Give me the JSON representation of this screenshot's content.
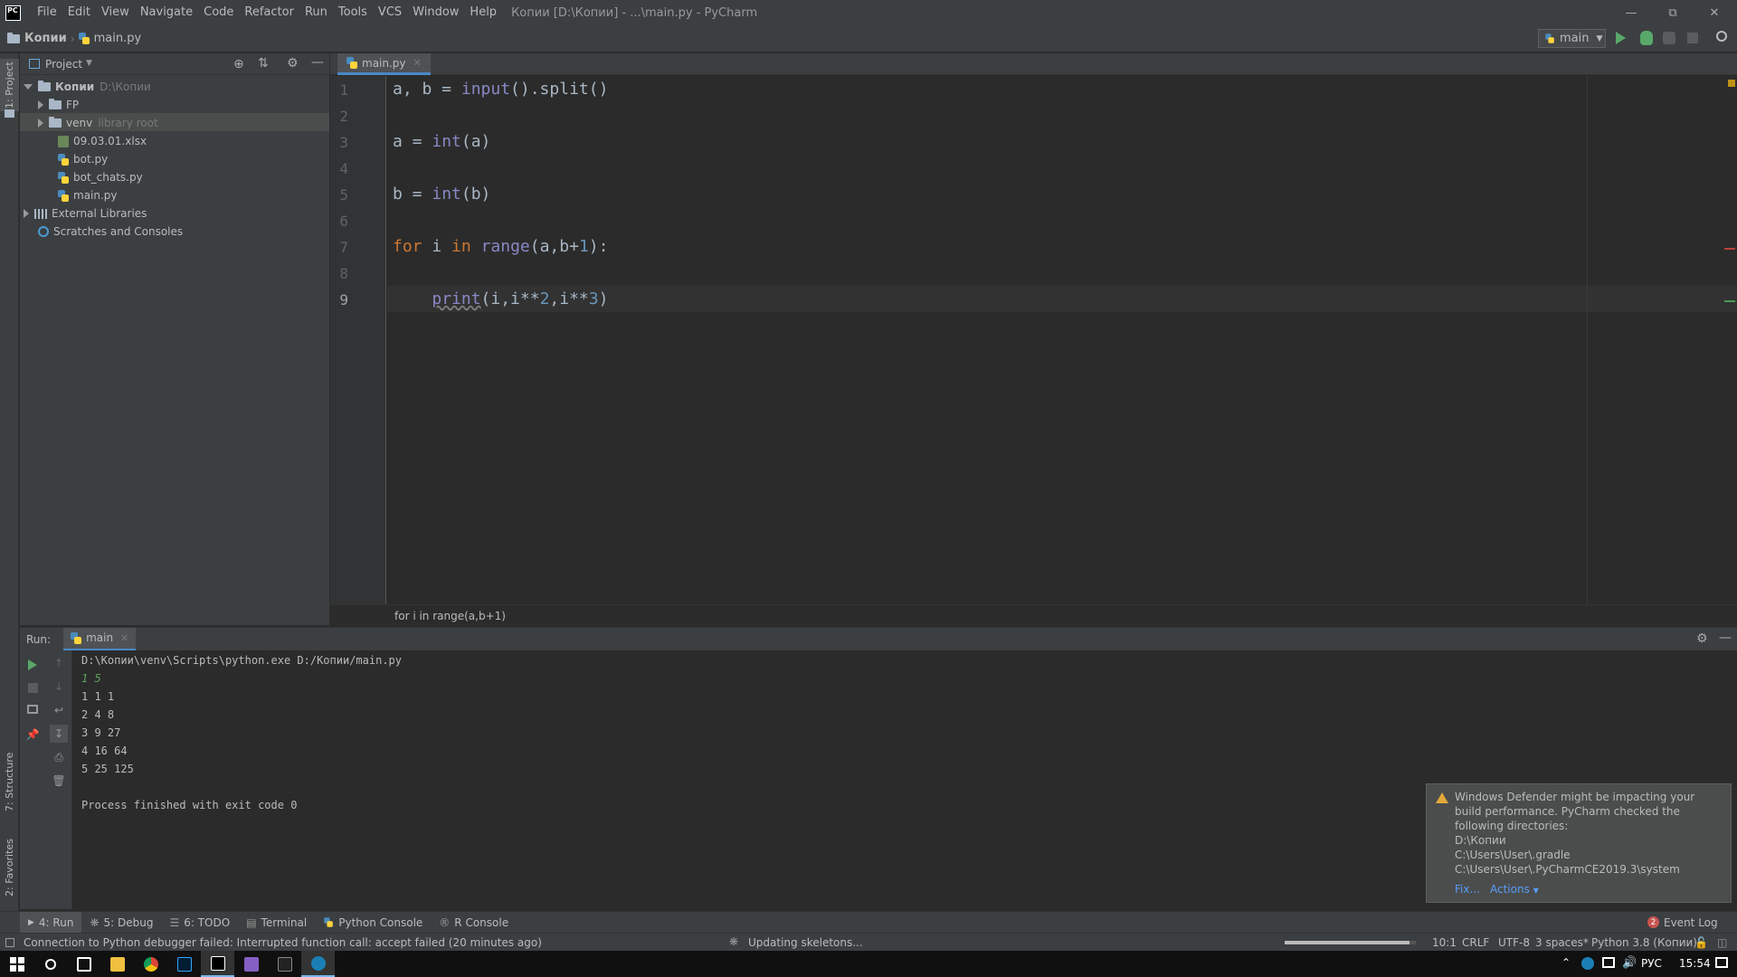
{
  "titlebar": {
    "logo": "PC",
    "menu": [
      "File",
      "Edit",
      "View",
      "Navigate",
      "Code",
      "Refactor",
      "Run",
      "Tools",
      "VCS",
      "Window",
      "Help"
    ],
    "window_title": "Копии [D:\\Копии] - ...\\main.py - PyCharm"
  },
  "navbar": {
    "crumb_project": "Копии",
    "crumb_file": "main.py",
    "run_config": "main"
  },
  "left_strip": {
    "project_tab": "1: Project",
    "structure_tab": "7: Structure",
    "favorites_tab": "2: Favorites"
  },
  "project": {
    "title": "Project",
    "root_name": "Копии",
    "root_path": "D:\\Копии",
    "items": [
      {
        "label": "FP",
        "hint": ""
      },
      {
        "label": "venv",
        "hint": "library root"
      },
      {
        "label": "09.03.01.xlsx",
        "hint": ""
      },
      {
        "label": "bot.py",
        "hint": ""
      },
      {
        "label": "bot_chats.py",
        "hint": ""
      },
      {
        "label": "main.py",
        "hint": ""
      }
    ],
    "external_libraries": "External Libraries",
    "scratches": "Scratches and Consoles"
  },
  "editor": {
    "tab_label": "main.py",
    "line_numbers": [
      "1",
      "2",
      "3",
      "4",
      "5",
      "6",
      "7",
      "8",
      "9"
    ],
    "code": {
      "l1_vars": "a, b = ",
      "l1_func": "input",
      "l1_rest": "().split()",
      "l3_pre": "a = ",
      "l3_func": "int",
      "l3_rest": "(a)",
      "l5_pre": "b = ",
      "l5_func": "int",
      "l5_rest": "(b)",
      "l7_for": "for",
      "l7_i": " i ",
      "l7_in": "in",
      "l7_sp": " ",
      "l7_func": "range",
      "l7_a": "(a,b+",
      "l7_num": "1",
      "l7_end": "):",
      "l9_indent": "    ",
      "l9_func": "print",
      "l9_a": "(i,i**",
      "l9_n1": "2",
      "l9_b": ",i**",
      "l9_n2": "3",
      "l9_c": ")"
    },
    "breadcrumb": "for i in range(a,b+1)"
  },
  "run": {
    "label": "Run:",
    "tab": "main",
    "output": [
      "D:\\Копии\\venv\\Scripts\\python.exe D:/Копии/main.py",
      "1 5",
      "1 1 1",
      "2 4 8",
      "3 9 27",
      "4 16 64",
      "5 25 125",
      "",
      "Process finished with exit code 0"
    ]
  },
  "notification": {
    "lines": [
      "Windows Defender might be impacting your",
      "build performance. PyCharm checked the",
      "following directories:",
      "D:\\Копии",
      "C:\\Users\\User\\.gradle",
      "C:\\Users\\User\\.PyCharmCE2019.3\\system"
    ],
    "fix": "Fix...",
    "actions": "Actions"
  },
  "bottom_tabs": {
    "run": "4: Run",
    "debug": "5: Debug",
    "todo": "6: TODO",
    "terminal": "Terminal",
    "python_console": "Python Console",
    "r_console": "R Console",
    "event_log_count": "2",
    "event_log": "Event Log"
  },
  "status": {
    "message": "Connection to Python debugger failed: Interrupted function call: accept failed (20 minutes ago)",
    "progress": "Updating skeletons...",
    "progress_fraction": 0.95,
    "position": "10:1",
    "line_sep": "CRLF",
    "encoding": "UTF-8",
    "indent": "3 spaces*",
    "interpreter": "Python 3.8 (Копии)"
  },
  "taskbar": {
    "language": "РУС",
    "time": "15:54"
  }
}
